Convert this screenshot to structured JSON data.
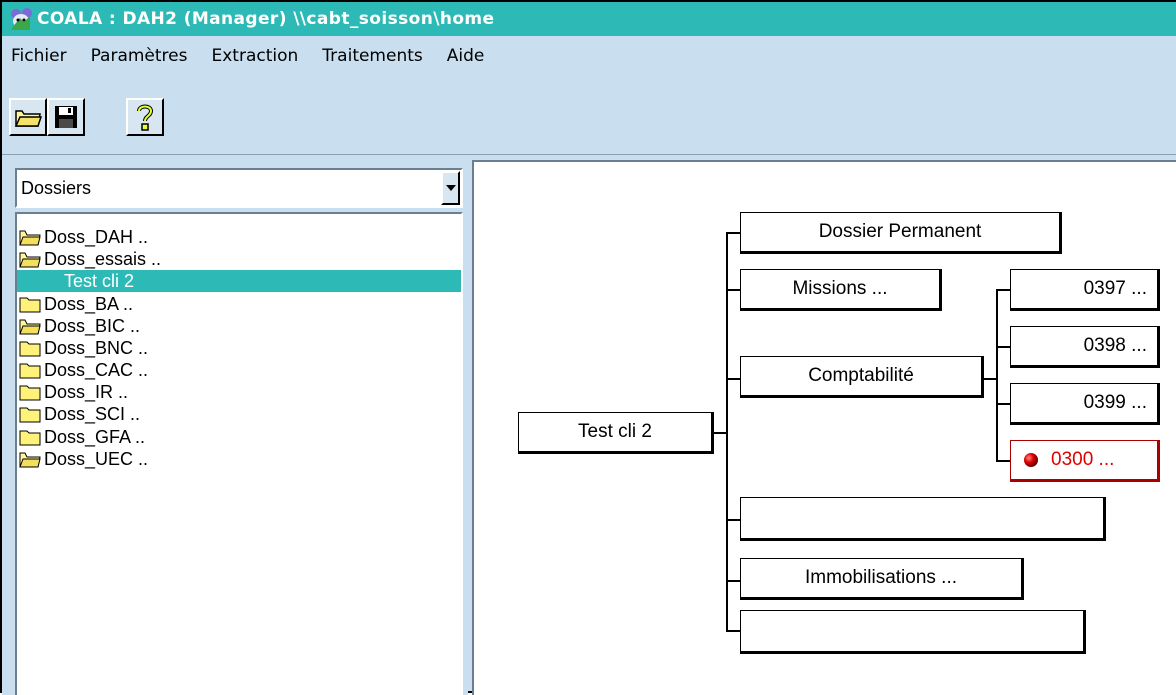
{
  "window": {
    "title": "COALA : DAH2 (Manager) \\\\cabt_soisson\\home"
  },
  "menu": [
    "Fichier",
    "Paramètres",
    "Extraction",
    "Traitements",
    "Aide"
  ],
  "toolbar": {
    "buttons": [
      {
        "icon": "open-folder-icon"
      },
      {
        "icon": "save-disk-icon"
      },
      {
        "icon": "help-question-icon"
      }
    ]
  },
  "left": {
    "combo_value": "Dossiers",
    "tree": [
      {
        "label": "Doss_DAH ..",
        "icon": "open-folder-icon",
        "selected": false
      },
      {
        "label": "Doss_essais ..",
        "icon": "open-folder-icon",
        "selected": false
      },
      {
        "label": "Test cli 2",
        "icon": "",
        "selected": true
      },
      {
        "label": "Doss_BA ..",
        "icon": "folder-icon",
        "selected": false
      },
      {
        "label": "Doss_BIC ..",
        "icon": "open-folder-icon",
        "selected": false
      },
      {
        "label": "Doss_BNC ..",
        "icon": "folder-icon",
        "selected": false
      },
      {
        "label": "Doss_CAC ..",
        "icon": "folder-icon",
        "selected": false
      },
      {
        "label": "Doss_IR ..",
        "icon": "folder-icon",
        "selected": false
      },
      {
        "label": "Doss_SCI ..",
        "icon": "folder-icon",
        "selected": false
      },
      {
        "label": "Doss_GFA ..",
        "icon": "folder-icon",
        "selected": false
      },
      {
        "label": "Doss_UEC ..",
        "icon": "open-folder-icon",
        "selected": false
      }
    ]
  },
  "diagram": {
    "root": "Test cli 2",
    "branches": [
      "Dossier Permanent",
      "Missions ...",
      "Comptabilité",
      "",
      "Immobilisations ...",
      ""
    ],
    "comptabilite_children": [
      {
        "label": "0397 ...",
        "alert": false
      },
      {
        "label": "0398 ...",
        "alert": false
      },
      {
        "label": "0399 ...",
        "alert": false
      },
      {
        "label": "0300 ...",
        "alert": true
      }
    ],
    "alert_color": "#e00000",
    "accent_color": "#2dbab7"
  }
}
